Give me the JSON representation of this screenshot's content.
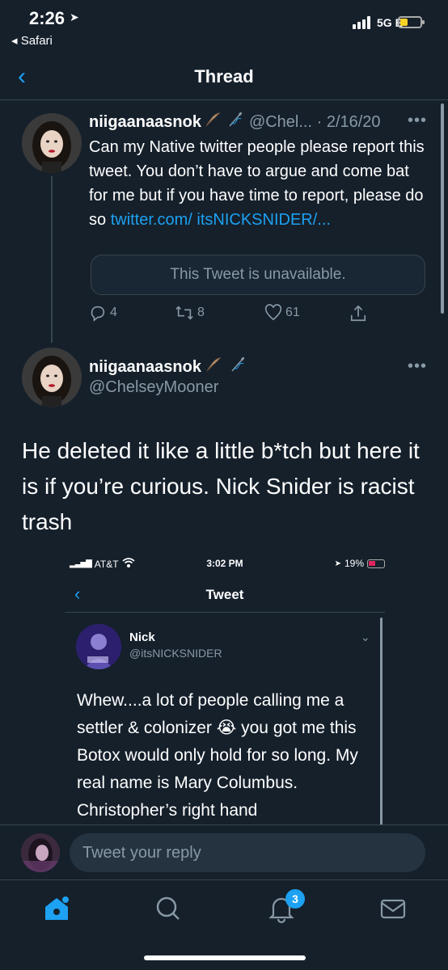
{
  "status_bar": {
    "time": "2:26",
    "back_app": "◂ Safari",
    "network": "5G E"
  },
  "nav": {
    "title": "Thread"
  },
  "tweet1": {
    "name": "niigaanaasnok",
    "handle_date": "@Chel... · 2/16/20",
    "body": "Can my Native twitter people please report this tweet. You don’t have to argue and come bat for me but if you have time to report, please do so ",
    "link": "twitter.com/ itsNICKSNIDER/...",
    "unavailable": "This Tweet is unavailable.",
    "replies": "4",
    "retweets": "8",
    "likes": "61"
  },
  "tweet2": {
    "name": "niigaanaasnok",
    "handle": "@ChelseyMooner",
    "body": "He deleted it like a little b*tch but here it is if you’re curious. Nick Snider is racist trash"
  },
  "embed": {
    "carrier": "AT&T",
    "time": "3:02 PM",
    "battery": "19%",
    "title": "Tweet",
    "name": "Nick",
    "handle": "@itsNICKSNIDER",
    "body_part1": "Whew....a lot of people calling me a settler & colonizer ",
    "emoji": "😭",
    "body_part2": " you got me this Botox would only hold for so long. My real name is Mary Columbus. Christopher’s right hand"
  },
  "reply": {
    "placeholder": "Tweet your reply"
  },
  "tabbar": {
    "notifications_badge": "3"
  },
  "colors": {
    "background": "#15202b",
    "accent": "#1da1f2",
    "muted": "#8899a6",
    "border": "#38444d"
  }
}
